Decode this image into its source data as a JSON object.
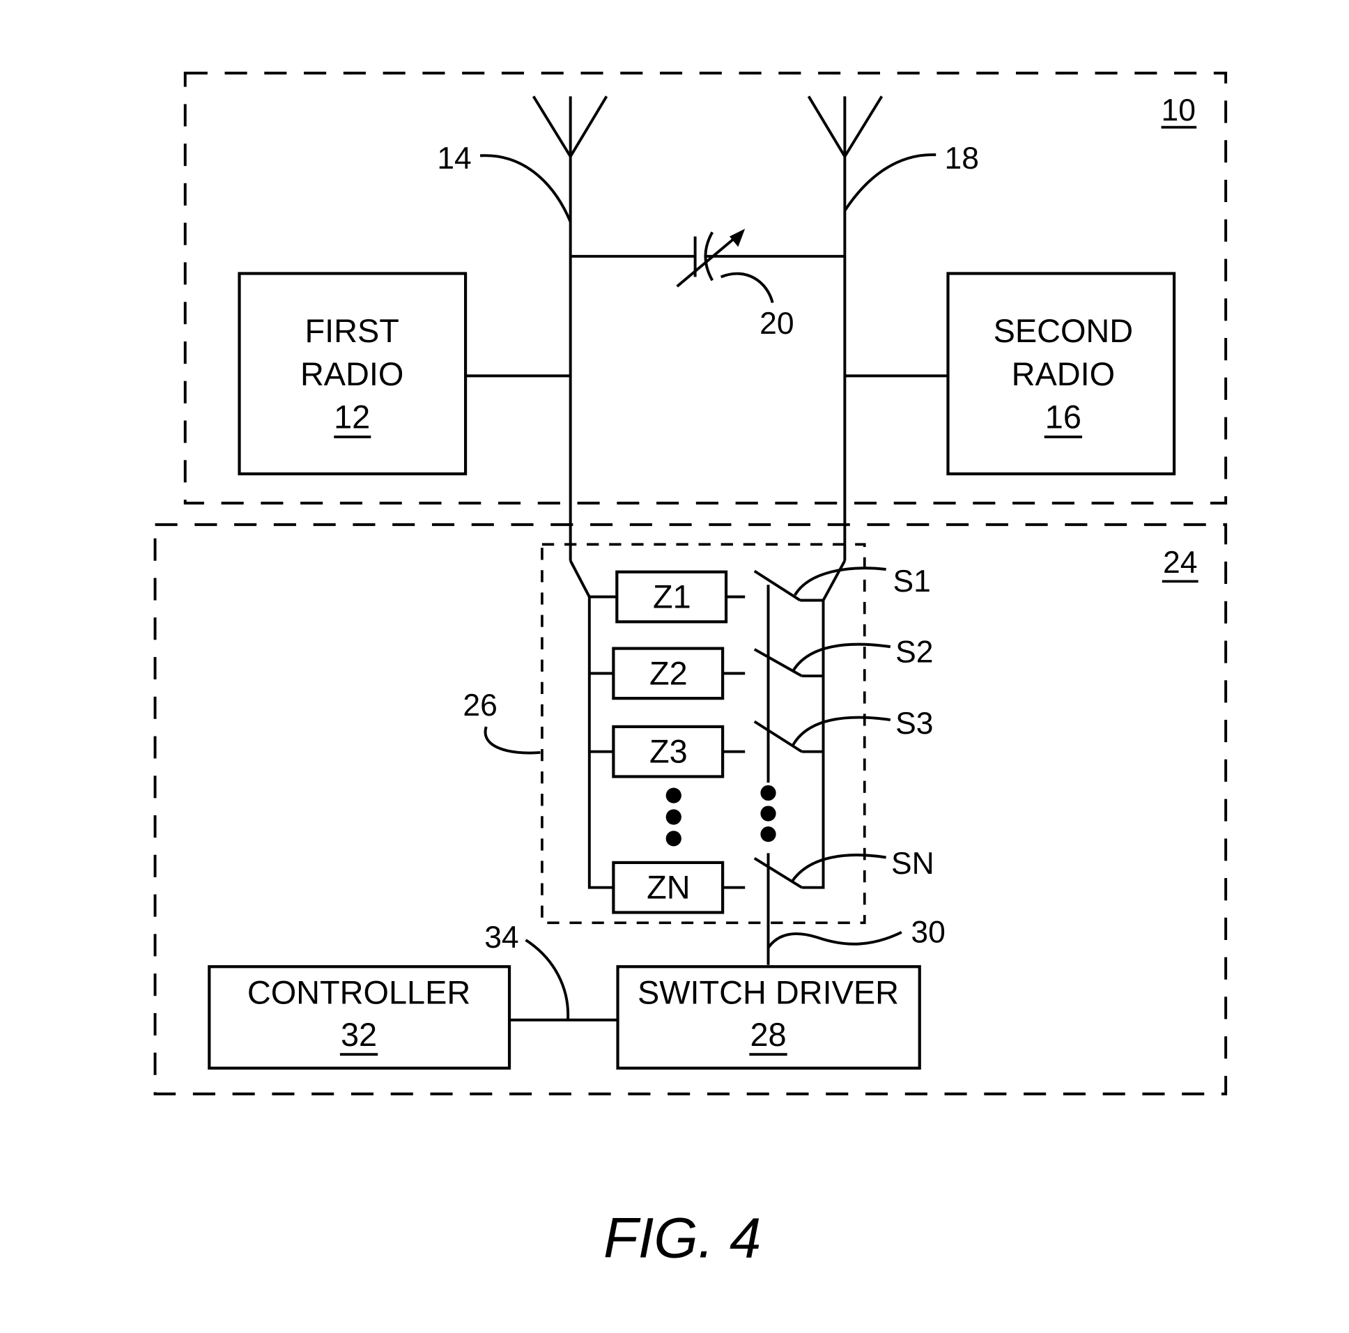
{
  "figure": {
    "caption": "FIG. 4",
    "colors": {
      "ink": "#000000",
      "background": "#ffffff"
    }
  },
  "device": {
    "ref": "10"
  },
  "antennas": [
    {
      "name": "first-antenna",
      "ref": "14"
    },
    {
      "name": "second-antenna",
      "ref": "18"
    }
  ],
  "tunable_capacitor": {
    "ref": "20"
  },
  "radios": [
    {
      "line1": "FIRST",
      "line2": "RADIO",
      "ref": "12"
    },
    {
      "line1": "SECOND",
      "line2": "RADIO",
      "ref": "16"
    }
  ],
  "tuning_circuit": {
    "ref": "24"
  },
  "impedance_network": {
    "ref": "26",
    "impedances": [
      "Z1",
      "Z2",
      "Z3",
      "ZN"
    ],
    "switches": [
      "S1",
      "S2",
      "S3",
      "SN"
    ]
  },
  "switch_driver": {
    "line1": "SWITCH DRIVER",
    "ref": "28"
  },
  "control_bus": {
    "ref": "30"
  },
  "controller": {
    "line1": "CONTROLLER",
    "ref": "32"
  },
  "controller_link": {
    "ref": "34"
  }
}
